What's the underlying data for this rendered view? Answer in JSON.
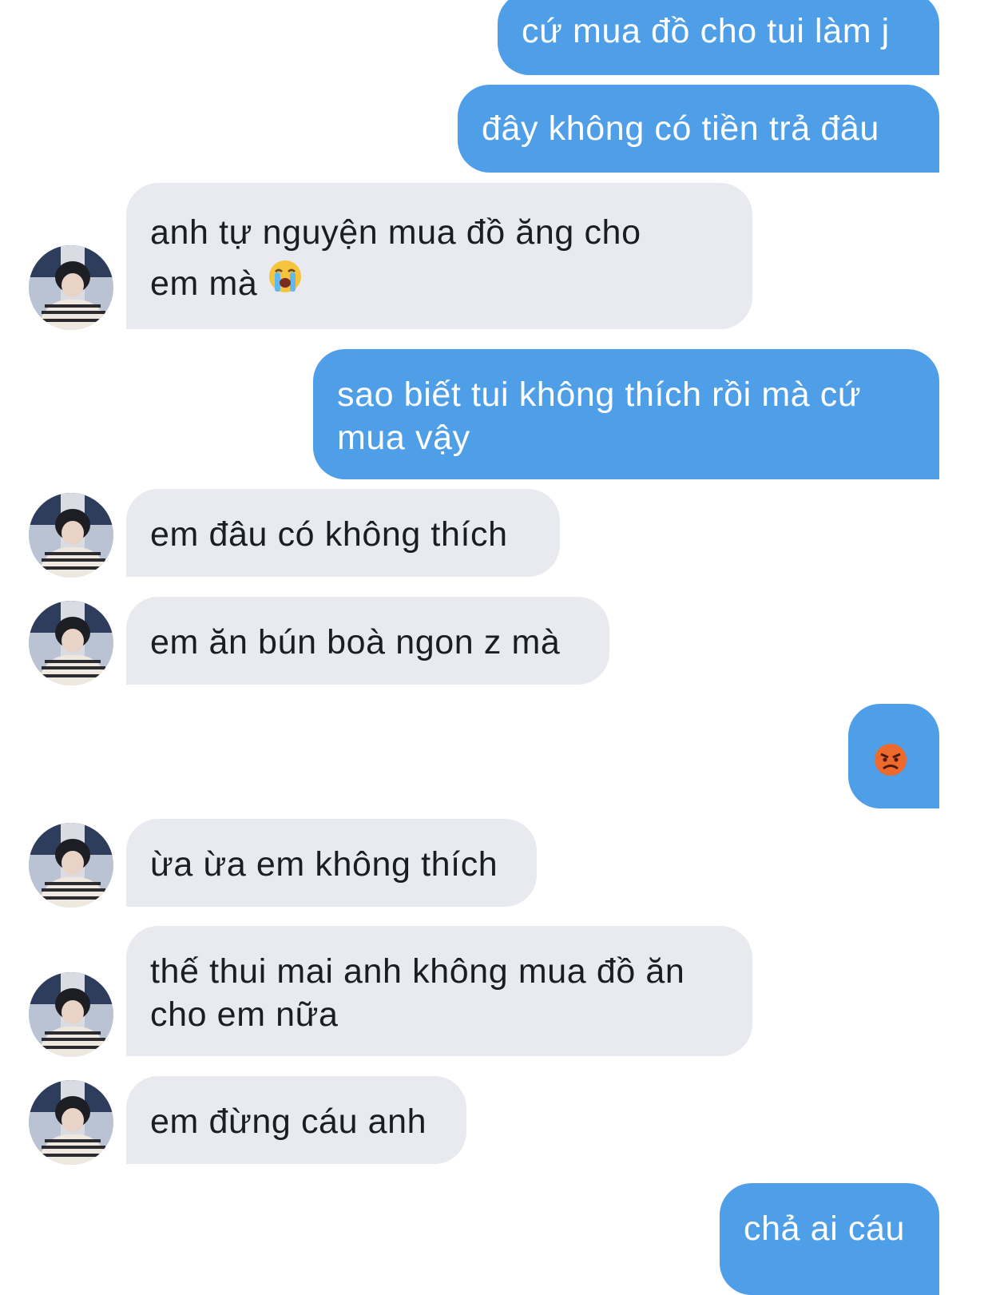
{
  "conversation": {
    "messages": [
      {
        "side": "sent",
        "lines": [
          "cứ mua đồ cho tui làm j"
        ]
      },
      {
        "side": "sent",
        "lines": [
          "đây không có tiền trả đâu"
        ]
      },
      {
        "side": "received",
        "lines": [
          "anh tự nguyện mua đồ ăng cho",
          "em mà"
        ],
        "emoji": "loudly-crying-face"
      },
      {
        "side": "sent",
        "lines": [
          "sao biết tui không thích rồi mà cứ",
          "mua vậy"
        ]
      },
      {
        "side": "received",
        "lines": [
          "em đâu có không thích"
        ]
      },
      {
        "side": "received",
        "lines": [
          "em ăn bún boà ngon z mà"
        ]
      },
      {
        "side": "sent",
        "lines": [],
        "emoji": "angry-face"
      },
      {
        "side": "received",
        "lines": [
          "ừa ừa em không thích"
        ]
      },
      {
        "side": "received",
        "lines": [
          "thế thui mai anh không mua đồ ăn",
          "cho em nữa"
        ]
      },
      {
        "side": "received",
        "lines": [
          "em đừng cáu anh"
        ]
      },
      {
        "side": "sent",
        "lines": [
          "chả ai cáu"
        ]
      }
    ]
  },
  "theme": {
    "sent_bubble_color": "#4e9fe8",
    "received_bubble_color": "#e8eaef",
    "background": "#ffffff"
  }
}
